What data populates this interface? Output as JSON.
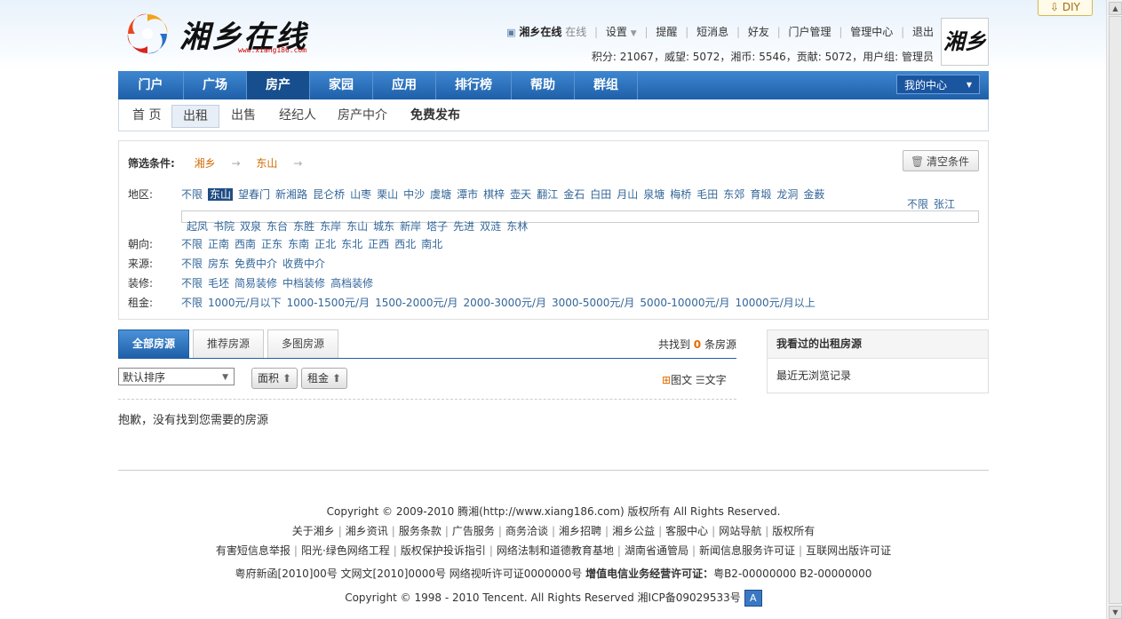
{
  "diy": "DIY",
  "logo": {
    "text": "湘乡在线",
    "url": "www.xiang186.com"
  },
  "userbar": {
    "name": "湘乡在线",
    "status": "在线",
    "links": [
      "设置",
      "提醒",
      "短消息",
      "好友",
      "门户管理",
      "管理中心",
      "退出"
    ],
    "credits": "积分: 21067，威望: 5072，湘币: 5546，贡献: 5072，用户组: 管理员",
    "avatar_text": "湘乡"
  },
  "nav": {
    "items": [
      "门户",
      "广场",
      "房产",
      "家园",
      "应用",
      "排行榜",
      "帮助",
      "群组"
    ],
    "active": "房产",
    "my_center": "我的中心"
  },
  "subnav": [
    "首 页",
    "出租",
    "出售",
    "经纪人",
    "房产中介",
    "免费发布"
  ],
  "filter": {
    "crumb_label": "筛选条件:",
    "crumb": [
      "湘乡",
      "东山"
    ],
    "clear": "清空条件",
    "region_label": "地区:",
    "regions": [
      "不限",
      "东山",
      "望春门",
      "新湘路",
      "昆仑桥",
      "山枣",
      "栗山",
      "中沙",
      "虞塘",
      "潭市",
      "棋梓",
      "壶天",
      "翻江",
      "金石",
      "白田",
      "月山",
      "泉塘",
      "梅桥",
      "毛田",
      "东郊",
      "育塅",
      "龙洞",
      "金薮"
    ],
    "region_extra": [
      "不限",
      "张江"
    ],
    "subregions": [
      "起凤",
      "书院",
      "双泉",
      "东台",
      "东胜",
      "东岸",
      "东山",
      "城东",
      "新岸",
      "塔子",
      "先进",
      "双涟",
      "东林"
    ],
    "orient_label": "朝向:",
    "orients": [
      "不限",
      "正南",
      "西南",
      "正东",
      "东南",
      "正北",
      "东北",
      "正西",
      "西北",
      "南北"
    ],
    "source_label": "来源:",
    "sources": [
      "不限",
      "房东",
      "免费中介",
      "收费中介"
    ],
    "decor_label": "装修:",
    "decors": [
      "不限",
      "毛坯",
      "简易装修",
      "中档装修",
      "高档装修"
    ],
    "rent_label": "租金:",
    "rents": [
      "不限",
      "1000元/月以下",
      "1000-1500元/月",
      "1500-2000元/月",
      "2000-3000元/月",
      "3000-5000元/月",
      "5000-10000元/月",
      "10000元/月以上"
    ]
  },
  "listing": {
    "tabs": [
      "全部房源",
      "推荐房源",
      "多图房源"
    ],
    "found_pre": "共找到",
    "found_count": "0",
    "found_post": "条房源",
    "sort": "默认排序",
    "btn_area": "面积",
    "btn_rent": "租金",
    "view_pic": "图文",
    "view_text": "文字",
    "empty": "抱歉，没有找到您需要的房源"
  },
  "side": {
    "title": "我看过的出租房源",
    "body": "最近无浏览记录"
  },
  "footer": {
    "copyright1": "Copyright © 2009-2010 腾湘(http://www.xiang186.com) 版权所有 All Rights Reserved.",
    "links1": [
      "关于湘乡",
      "湘乡资讯",
      "服务条款",
      "广告服务",
      "商务洽谈",
      "湘乡招聘",
      "湘乡公益",
      "客服中心",
      "网站导航",
      "版权所有"
    ],
    "links2": [
      "有害短信息举报",
      "阳光·绿色网络工程",
      "版权保护投诉指引",
      "网络法制和道德教育基地",
      "湖南省通管局",
      "新闻信息服务许可证",
      "互联网出版许可证"
    ],
    "license": "粤府新函[2010]00号 文网文[2010]0000号 网络视听许可证0000000号",
    "license_bold": "增值电信业务经营许可证：",
    "license_tail": "粤B2-00000000 B2-00000000",
    "copyright2": "Copyright © 1998 - 2010 Tencent. All Rights Reserved 湘ICP备09029533号",
    "badge": "A"
  }
}
